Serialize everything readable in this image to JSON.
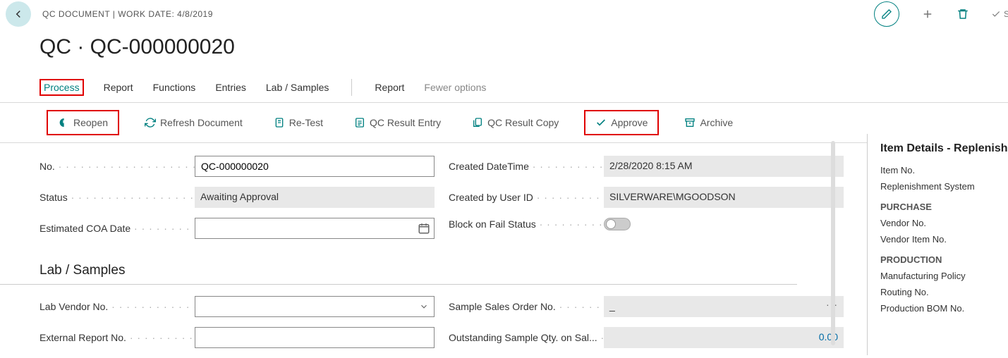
{
  "header": {
    "breadcrumb": "QC DOCUMENT | WORK DATE: 4/8/2019",
    "title": "QC · QC-000000020",
    "saved_label": "SA"
  },
  "tabs": {
    "process": "Process",
    "report1": "Report",
    "functions": "Functions",
    "entries": "Entries",
    "lab_samples": "Lab / Samples",
    "report2": "Report",
    "fewer": "Fewer options"
  },
  "actions": {
    "reopen": "Reopen",
    "refresh": "Refresh Document",
    "retest": "Re-Test",
    "result_entry": "QC Result Entry",
    "result_copy": "QC Result Copy",
    "approve": "Approve",
    "archive": "Archive"
  },
  "fields": {
    "no_label": "No.",
    "no_value": "QC-000000020",
    "status_label": "Status",
    "status_value": "Awaiting Approval",
    "coa_label": "Estimated COA Date",
    "coa_value": "",
    "created_dt_label": "Created DateTime",
    "created_dt_value": "2/28/2020 8:15 AM",
    "created_by_label": "Created by User ID",
    "created_by_value": "SILVERWARE\\MGOODSON",
    "block_label": "Block on Fail Status"
  },
  "section": {
    "lab_samples_title": "Lab / Samples",
    "lab_vendor_label": "Lab Vendor No.",
    "lab_vendor_value": "",
    "external_report_label": "External Report No.",
    "external_report_value": "",
    "sample_so_label": "Sample Sales Order No.",
    "sample_so_value": "_",
    "outstanding_label": "Outstanding Sample Qty. on Sal...",
    "outstanding_value": "0.00"
  },
  "side": {
    "title": "Item Details - Replenish",
    "item_no": "Item No.",
    "repl_system": "Replenishment System",
    "purchase": "PURCHASE",
    "vendor_no": "Vendor No.",
    "vendor_item_no": "Vendor Item No.",
    "production": "PRODUCTION",
    "mfg_policy": "Manufacturing Policy",
    "routing_no": "Routing No.",
    "prod_bom_no": "Production BOM No."
  }
}
